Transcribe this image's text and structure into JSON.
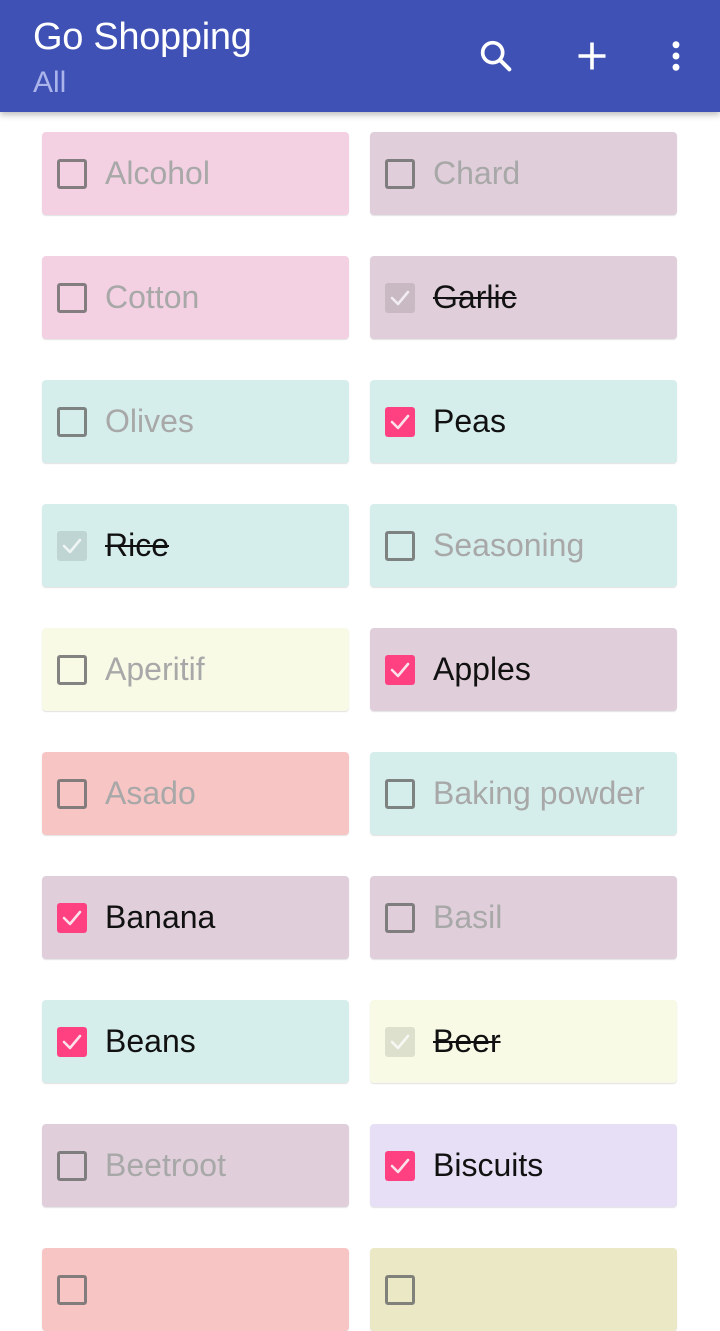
{
  "appbar": {
    "title": "Go Shopping",
    "subtitle": "All",
    "actions": [
      {
        "name": "search-icon",
        "label": "Search"
      },
      {
        "name": "add-icon",
        "label": "Add"
      },
      {
        "name": "more-vert-icon",
        "label": "More options"
      }
    ],
    "background": "#3f51b5"
  },
  "accent_color": "#ff4081",
  "items": [
    {
      "label": "Alcohol",
      "state": "unchecked",
      "color": "#f3d1e2"
    },
    {
      "label": "Chard",
      "state": "unchecked",
      "color": "#e0cfda"
    },
    {
      "label": "Cotton",
      "state": "unchecked",
      "color": "#f3d1e2"
    },
    {
      "label": "Garlic",
      "state": "done",
      "color": "#e0cfda"
    },
    {
      "label": "Olives",
      "state": "unchecked",
      "color": "#d5eeec"
    },
    {
      "label": "Peas",
      "state": "checked",
      "color": "#d5eeec"
    },
    {
      "label": "Rice",
      "state": "done",
      "color": "#d5eeec"
    },
    {
      "label": "Seasoning",
      "state": "unchecked",
      "color": "#d5eeec"
    },
    {
      "label": "Aperitif",
      "state": "unchecked",
      "color": "#f8fae6"
    },
    {
      "label": "Apples",
      "state": "checked",
      "color": "#e0cfda"
    },
    {
      "label": "Asado",
      "state": "unchecked",
      "color": "#f8c5c5"
    },
    {
      "label": "Baking powder",
      "state": "unchecked",
      "color": "#d5eeec"
    },
    {
      "label": "Banana",
      "state": "checked",
      "color": "#e0cfda"
    },
    {
      "label": "Basil",
      "state": "unchecked",
      "color": "#e0cfda"
    },
    {
      "label": "Beans",
      "state": "checked",
      "color": "#d5eeec"
    },
    {
      "label": "Beer",
      "state": "done",
      "color": "#f8fae6"
    },
    {
      "label": "Beetroot",
      "state": "unchecked",
      "color": "#e0cfda"
    },
    {
      "label": "Biscuits",
      "state": "checked",
      "color": "#e7dff5"
    },
    {
      "label": "",
      "state": "unchecked",
      "color": "#f8c5c5"
    },
    {
      "label": "",
      "state": "unchecked",
      "color": "#ebe8c5"
    }
  ]
}
